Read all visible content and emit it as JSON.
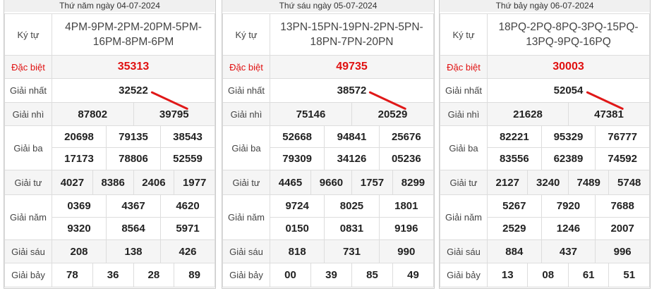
{
  "labels": {
    "ky_tu": "Ký tự",
    "dac_biet": "Đặc biệt",
    "giai_nhat": "Giải nhất",
    "giai_nhi": "Giải nhì",
    "giai_ba": "Giải ba",
    "giai_tu": "Giải tư",
    "giai_nam": "Giải năm",
    "giai_sau": "Giải sáu",
    "giai_bay": "Giải bảy"
  },
  "panels": [
    {
      "title": "Thứ năm ngày 04-07-2024",
      "codes": "4PM-9PM-2PM-20PM-5PM-16PM-8PM-6PM",
      "dac_biet": "35313",
      "giai_nhat": "32522",
      "giai_nhi": [
        "87802",
        "39795"
      ],
      "giai_ba": [
        "20698",
        "79135",
        "38543",
        "17173",
        "78806",
        "52559"
      ],
      "giai_tu": [
        "4027",
        "8386",
        "2406",
        "1977"
      ],
      "giai_nam": [
        "0369",
        "4367",
        "4620",
        "9320",
        "8564",
        "5971"
      ],
      "giai_sau": [
        "208",
        "138",
        "426"
      ],
      "giai_bay": [
        "78",
        "36",
        "28",
        "89"
      ]
    },
    {
      "title": "Thứ sáu ngày 05-07-2024",
      "codes": "13PN-15PN-19PN-2PN-5PN-18PN-7PN-20PN",
      "dac_biet": "49735",
      "giai_nhat": "38572",
      "giai_nhi": [
        "75146",
        "20529"
      ],
      "giai_ba": [
        "52668",
        "94841",
        "25676",
        "79309",
        "34126",
        "05236"
      ],
      "giai_tu": [
        "4465",
        "9660",
        "1757",
        "8299"
      ],
      "giai_nam": [
        "9724",
        "8025",
        "1801",
        "0150",
        "0831",
        "9196"
      ],
      "giai_sau": [
        "818",
        "731",
        "990"
      ],
      "giai_bay": [
        "00",
        "39",
        "85",
        "49"
      ]
    },
    {
      "title": "Thứ bảy ngày 06-07-2024",
      "codes": "18PQ-2PQ-8PQ-3PQ-15PQ-13PQ-9PQ-16PQ",
      "dac_biet": "30003",
      "giai_nhat": "52054",
      "giai_nhi": [
        "21628",
        "47381"
      ],
      "giai_ba": [
        "82221",
        "95329",
        "76777",
        "83556",
        "62389",
        "74592"
      ],
      "giai_tu": [
        "2127",
        "3240",
        "7489",
        "5748"
      ],
      "giai_nam": [
        "5267",
        "7920",
        "7688",
        "2529",
        "1246",
        "2007"
      ],
      "giai_sau": [
        "884",
        "437",
        "996"
      ],
      "giai_bay": [
        "13",
        "08",
        "61",
        "51"
      ]
    }
  ],
  "colors": {
    "accent_red": "#e01010",
    "border": "#dddddd",
    "alt_row": "#f5f5f5"
  }
}
